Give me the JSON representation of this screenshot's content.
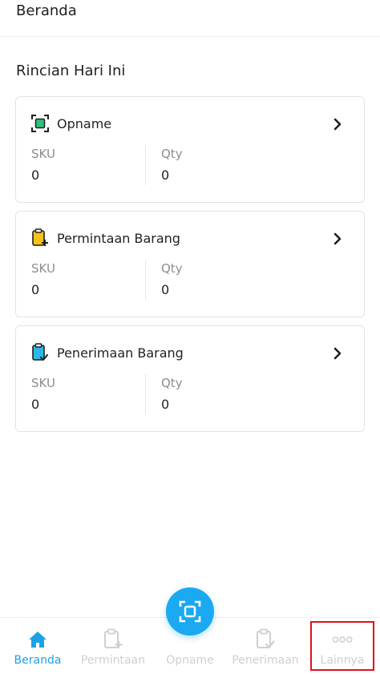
{
  "header": {
    "title": "Beranda"
  },
  "section": {
    "title": "Rincian Hari Ini"
  },
  "cards": [
    {
      "title": "Opname",
      "icon": "scan-icon",
      "sku_label": "SKU",
      "sku_value": "0",
      "qty_label": "Qty",
      "qty_value": "0"
    },
    {
      "title": "Permintaan Barang",
      "icon": "clipboard-plus-icon",
      "sku_label": "SKU",
      "sku_value": "0",
      "qty_label": "Qty",
      "qty_value": "0"
    },
    {
      "title": "Penerimaan Barang",
      "icon": "clipboard-check-icon",
      "sku_label": "SKU",
      "sku_value": "0",
      "qty_label": "Qty",
      "qty_value": "0"
    }
  ],
  "bottom_nav": {
    "items": [
      {
        "label": "Beranda",
        "icon": "home-icon",
        "active": true
      },
      {
        "label": "Permintaan",
        "icon": "clipboard-plus-icon",
        "active": false
      },
      {
        "label": "Opname",
        "icon": "scan-icon",
        "active": false
      },
      {
        "label": "Penerimaan",
        "icon": "clipboard-check-icon",
        "active": false
      },
      {
        "label": "Lainnya",
        "icon": "more-dots-icon",
        "active": false
      }
    ]
  },
  "colors": {
    "accent": "#1ba9f2",
    "nav_active": "#1da1e6",
    "nav_inactive": "#cfcfcf",
    "icon_green": "#2ec27e",
    "icon_yellow": "#f6c21a",
    "icon_blue": "#2bb7e8",
    "highlight": "#e0111b"
  }
}
